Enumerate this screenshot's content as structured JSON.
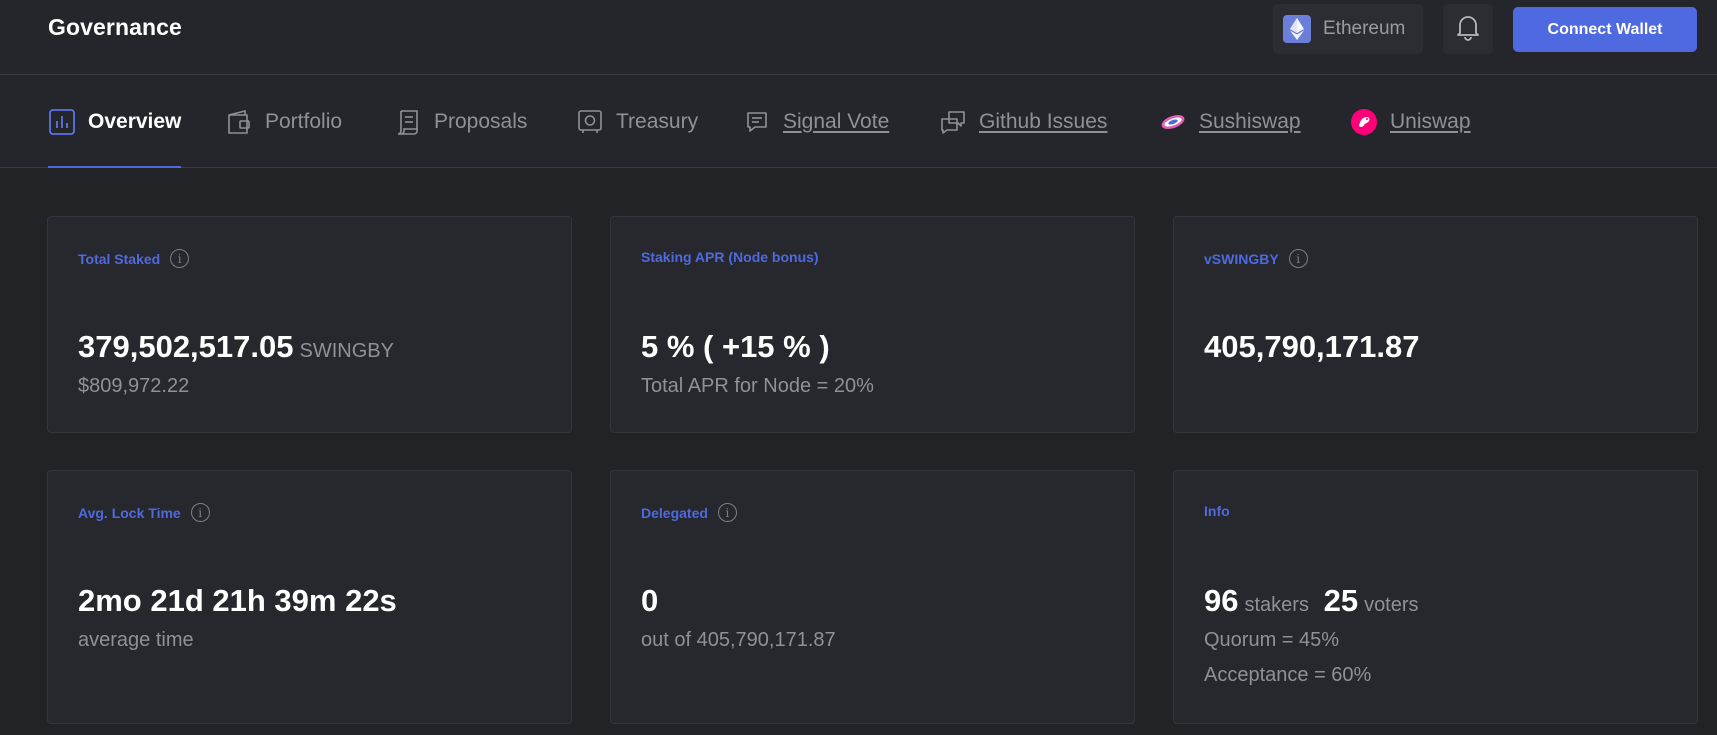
{
  "header": {
    "brand": "Governance",
    "network": {
      "label": "Ethereum",
      "icon": "ethereum-icon"
    },
    "bell_icon": "bell-icon",
    "connect_label": "Connect Wallet"
  },
  "tabs": [
    {
      "label": "Overview",
      "icon": "bar-chart-icon",
      "active": true
    },
    {
      "label": "Portfolio",
      "icon": "wallet-icon"
    },
    {
      "label": "Proposals",
      "icon": "scroll-icon"
    },
    {
      "label": "Treasury",
      "icon": "safe-icon"
    },
    {
      "label": "Signal Vote",
      "icon": "chat-icon"
    },
    {
      "label": "Github Issues",
      "icon": "chat-bubbles-icon"
    },
    {
      "label": "Sushiswap",
      "icon": "sushiswap-icon"
    },
    {
      "label": "Uniswap",
      "icon": "uniswap-icon"
    }
  ],
  "cards": {
    "total_staked": {
      "title": "Total Staked",
      "value": "379,502,517.05",
      "unit": "SWINGBY",
      "sub": "$809,972.22"
    },
    "staking_apr": {
      "title": "Staking APR (Node bonus)",
      "value": "5 % ( +15 % )",
      "sub": "Total APR for Node = 20%"
    },
    "vswingby": {
      "title": "vSWINGBY",
      "value": "405,790,171.87"
    },
    "avg_lock": {
      "title": "Avg. Lock Time",
      "value": "2mo 21d 21h 39m 22s",
      "sub": "average time"
    },
    "delegated": {
      "title": "Delegated",
      "value": "0",
      "sub": "out of 405,790,171.87"
    },
    "info": {
      "title": "Info",
      "stakers_value": "96",
      "stakers_label": "stakers",
      "voters_value": "25",
      "voters_label": "voters",
      "quorum": "Quorum = 45%",
      "acceptance": "Acceptance = 60%"
    }
  },
  "colors": {
    "accent": "#4f6ae0",
    "background": "#212327",
    "card": "#26282d"
  }
}
